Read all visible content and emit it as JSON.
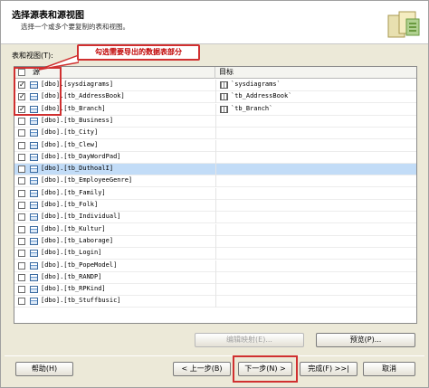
{
  "header": {
    "title": "选择源表和源视图",
    "subtitle": "选择一个或多个要复制的表和视图。"
  },
  "tables_label": "表和视图(T):",
  "callout": "勾选需要导出的数据表部分",
  "columns": {
    "source": "源",
    "destination": "目标"
  },
  "rows": [
    {
      "source": "[dbo].[sysdiagrams]",
      "checked": true,
      "destination": "`sysdiagrams`"
    },
    {
      "source": "[dbo].[tb_AddressBook]",
      "checked": true,
      "destination": "`tb_AddressBook`"
    },
    {
      "source": "[dbo].[tb_Branch]",
      "checked": true,
      "destination": "`tb_Branch`"
    },
    {
      "source": "[dbo].[tb_Business]",
      "checked": false,
      "destination": ""
    },
    {
      "source": "[dbo].[tb_City]",
      "checked": false,
      "destination": ""
    },
    {
      "source": "[dbo].[tb_Clew]",
      "checked": false,
      "destination": ""
    },
    {
      "source": "[dbo].[tb_DayWordPad]",
      "checked": false,
      "destination": ""
    },
    {
      "source": "[dbo].[tb_DuthoalI]",
      "checked": false,
      "destination": "",
      "selected": true
    },
    {
      "source": "[dbo].[tb_EmployeeGenre]",
      "checked": false,
      "destination": ""
    },
    {
      "source": "[dbo].[tb_Family]",
      "checked": false,
      "destination": ""
    },
    {
      "source": "[dbo].[tb_Folk]",
      "checked": false,
      "destination": ""
    },
    {
      "source": "[dbo].[tb_Individual]",
      "checked": false,
      "destination": ""
    },
    {
      "source": "[dbo].[tb_Kultur]",
      "checked": false,
      "destination": ""
    },
    {
      "source": "[dbo].[tb_Laborage]",
      "checked": false,
      "destination": ""
    },
    {
      "source": "[dbo].[tb_Login]",
      "checked": false,
      "destination": ""
    },
    {
      "source": "[dbo].[tb_PopeModel]",
      "checked": false,
      "destination": ""
    },
    {
      "source": "[dbo].[tb_RANDP]",
      "checked": false,
      "destination": ""
    },
    {
      "source": "[dbo].[tb_RPKind]",
      "checked": false,
      "destination": ""
    },
    {
      "source": "[dbo].[tb_Stuffbusic]",
      "checked": false,
      "destination": ""
    }
  ],
  "buttons": {
    "edit_mapping": "编辑映射(E)...",
    "preview": "预览(P)...",
    "help": "帮助(H)",
    "back": "< 上一步(B)",
    "next": "下一步(N) >",
    "finish": "完成(F) >>|",
    "cancel": "取消"
  },
  "colors": {
    "highlight_red": "#d03030",
    "selected_row": "#c2dcf7",
    "window_bg": "#ece9d8"
  }
}
